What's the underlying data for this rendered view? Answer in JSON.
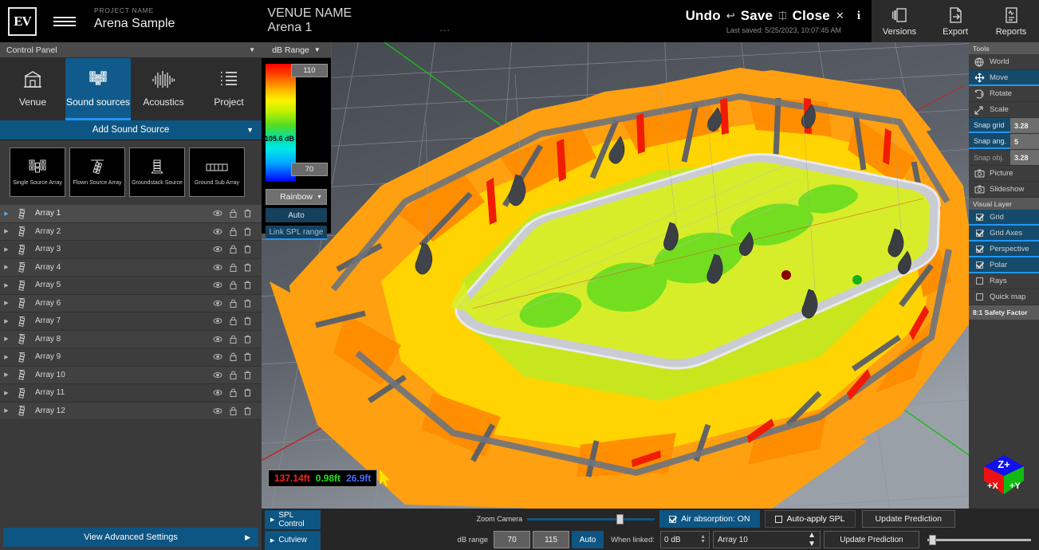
{
  "topbar": {
    "logo": "EV",
    "menu_icon": "hamburger-icon",
    "project_label": "PROJECT NAME",
    "project_name": "Arena Sample",
    "venue_label": "VENUE NAME",
    "venue_name": "Arena 1",
    "ellipsis": "...",
    "undo": "Undo",
    "save": "Save",
    "close": "Close",
    "info": "i",
    "last_saved": "Last saved: 5/25/2023, 10:07:45 AM",
    "right_buttons": [
      {
        "label": "Versions",
        "icon": "versions-icon"
      },
      {
        "label": "Export",
        "icon": "export-icon"
      },
      {
        "label": "Reports",
        "icon": "reports-icon"
      }
    ]
  },
  "control_panel": {
    "title": "Control Panel",
    "tabs": [
      {
        "label": "Venue",
        "icon": "venue-icon",
        "active": false
      },
      {
        "label": "Sound sources",
        "icon": "sound-sources-icon",
        "active": true
      },
      {
        "label": "Acoustics",
        "icon": "acoustics-icon",
        "active": false
      },
      {
        "label": "Project",
        "icon": "project-icon",
        "active": false
      }
    ],
    "add_sound_source": "Add Sound Source",
    "source_cards": [
      {
        "label": "Single Source Array",
        "icon": "single-source-array-icon"
      },
      {
        "label": "Flown Source Array",
        "icon": "flown-source-array-icon"
      },
      {
        "label": "Groundstack Source",
        "icon": "groundstack-source-icon"
      },
      {
        "label": "Ground Sub Array",
        "icon": "ground-sub-array-icon"
      }
    ],
    "arrays": [
      {
        "name": "Array 1",
        "selected": true
      },
      {
        "name": "Array 2",
        "selected": false
      },
      {
        "name": "Array 3",
        "selected": false
      },
      {
        "name": "Array 4",
        "selected": false
      },
      {
        "name": "Array 5",
        "selected": false
      },
      {
        "name": "Array 6",
        "selected": false
      },
      {
        "name": "Array 7",
        "selected": false
      },
      {
        "name": "Array 8",
        "selected": false
      },
      {
        "name": "Array 9",
        "selected": false
      },
      {
        "name": "Array 10",
        "selected": false
      },
      {
        "name": "Array 11",
        "selected": false
      },
      {
        "name": "Array 12",
        "selected": false
      }
    ],
    "row_action_icons": [
      "eye-icon",
      "lock-icon",
      "delete-icon"
    ],
    "advanced_settings": "View Advanced Settings"
  },
  "db_range_panel": {
    "title": "dB Range",
    "max": "110",
    "min": "70",
    "current": "105.6 dB",
    "palette": "Rainbow",
    "auto": "Auto",
    "link_spl": "Link SPL range"
  },
  "viewport": {
    "coord_x": "137.14ft",
    "coord_y": "0.98ft",
    "coord_z": "26.9ft",
    "nav_cube": {
      "top": "Z+",
      "left": "+X",
      "right": "+Y"
    }
  },
  "tools_panel": {
    "section_tools": "Tools",
    "items": [
      {
        "label": "World",
        "icon": "globe-icon",
        "active": false
      },
      {
        "label": "Move",
        "icon": "move-icon",
        "active": true
      },
      {
        "label": "Rotate",
        "icon": "rotate-icon",
        "active": false
      },
      {
        "label": "Scale",
        "icon": "scale-icon",
        "active": false
      }
    ],
    "snaps": [
      {
        "label": "Snap grid",
        "value": "3.28",
        "active": true
      },
      {
        "label": "Snap ang.",
        "value": "5",
        "active": true
      },
      {
        "label": "Snap obj.",
        "value": "3.28",
        "active": false
      }
    ],
    "capture": [
      {
        "label": "Picture",
        "icon": "camera-icon"
      },
      {
        "label": "Slideshow",
        "icon": "slideshow-icon"
      }
    ],
    "section_visual": "Visual Layer",
    "layers": [
      {
        "label": "Grid",
        "checked": true
      },
      {
        "label": "Grid Axes",
        "checked": true
      },
      {
        "label": "Perspective",
        "checked": true
      },
      {
        "label": "Polar",
        "checked": true
      },
      {
        "label": "Rays",
        "checked": false
      },
      {
        "label": "Quick map",
        "checked": false
      }
    ],
    "safety_factor": "8:1 Safety Factor"
  },
  "bottom_bar": {
    "spl_control": "SPL Control",
    "cutview": "Cutview",
    "zoom_camera_label": "Zoom Camera",
    "air_absorption": "Air absorption: ON",
    "auto_apply_spl": "Auto-apply SPL",
    "update_prediction": "Update Prediction",
    "db_range_label": "dB range",
    "db_min": "70",
    "db_max": "115",
    "auto": "Auto",
    "when_linked_label": "When linked:",
    "when_linked_value": "0 dB",
    "array_select": "Array 10",
    "update_prediction_2": "Update Prediction"
  }
}
